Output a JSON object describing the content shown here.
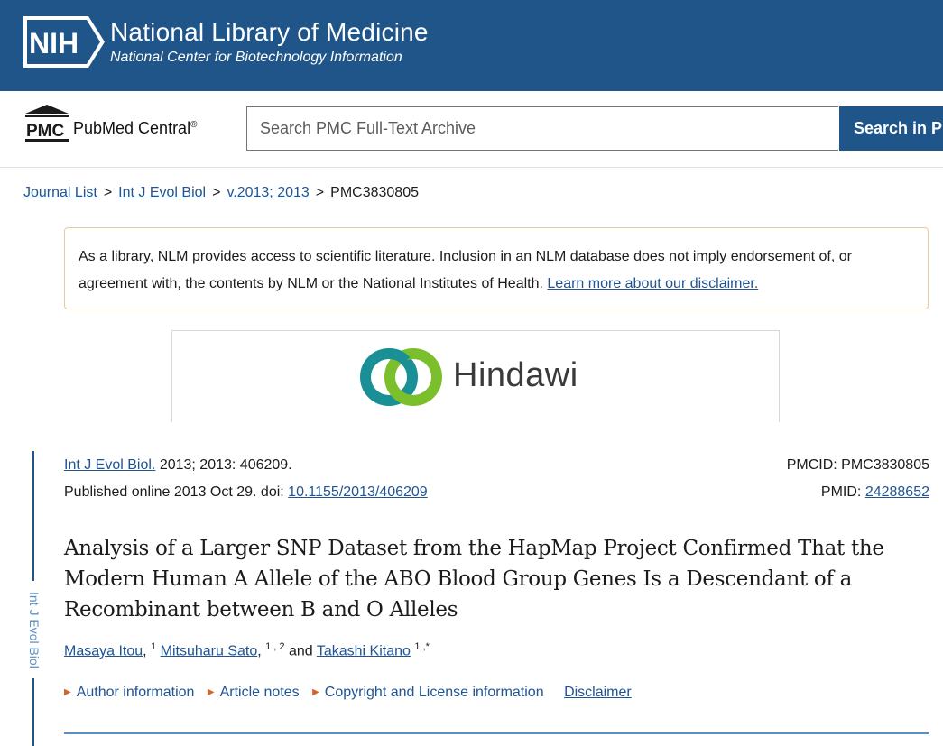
{
  "nih_banner": {
    "logo_text": "NIH",
    "title": "National Library of Medicine",
    "subtitle": "National Center for Biotechnology Information"
  },
  "pmc_header": {
    "logo_abbr": "PMC",
    "logo_name": "PubMed Central",
    "logo_reg": "®",
    "search_placeholder": "Search PMC Full-Text Archive",
    "search_button": "Search in PMC"
  },
  "breadcrumb": {
    "items": [
      "Journal List",
      "Int J Evol Biol",
      "v.2013; 2013"
    ],
    "separator": ">",
    "current": "PMC3830805"
  },
  "disclaimer": {
    "text": "As a library, NLM provides access to scientific literature. Inclusion in an NLM database does not imply endorsement of, or agreement with, the contents by NLM or the National Institutes of Health. ",
    "link": "Learn more about our disclaimer."
  },
  "publisher": {
    "name": "Hindawi",
    "colors": {
      "teal": "#1a8f96",
      "green": "#7bbf2c",
      "text": "#3a3a3a"
    }
  },
  "sidebar": {
    "journal_vertical": "Int J Evol Biol"
  },
  "article": {
    "journal_link": "Int J Evol Biol.",
    "citation_rest": " 2013; 2013: 406209.",
    "published_prefix": "Published online 2013 Oct 29. doi: ",
    "doi": "10.1155/2013/406209",
    "pmcid_label": "PMCID: ",
    "pmcid": "PMC3830805",
    "pmid_label": "PMID: ",
    "pmid": "24288652",
    "title": "Analysis of a Larger SNP Dataset from the HapMap Project Confirmed That the Modern Human A Allele of the ABO Blood Group Genes Is a Descendant of a Recombinant between B and O Alleles",
    "authors": [
      {
        "name": "Masaya Itou",
        "sup": "1"
      },
      {
        "name": "Mitsuharu Sato",
        "sup": "1 , 2"
      },
      {
        "name": "Takashi Kitano",
        "sup": "1 ,*"
      }
    ],
    "author_sep_1": ", ",
    "author_sep_2": ", ",
    "author_and": " and ",
    "info_links": [
      "Author information",
      "Article notes",
      "Copyright and License information"
    ],
    "disclaimer_link": "Disclaimer"
  },
  "colors": {
    "banner_blue": "#20558a",
    "link_blue": "#205493",
    "triangle_orange": "#d4642b",
    "disclaimer_border": "#e8c89e"
  }
}
